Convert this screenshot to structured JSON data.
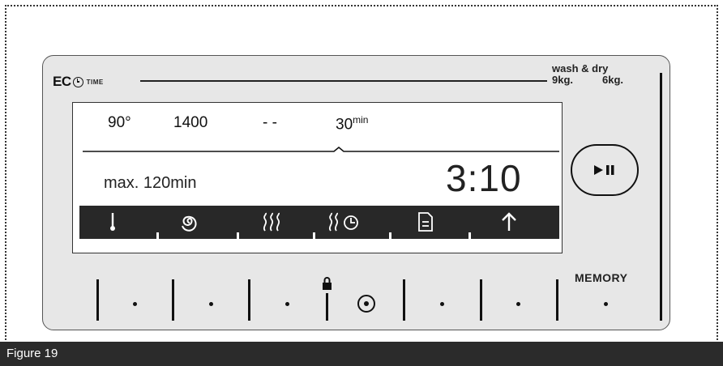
{
  "logo": {
    "eco": "EC",
    "time": "TIME"
  },
  "capacity": {
    "label": "wash & dry",
    "wash": "9kg.",
    "dry": "6kg."
  },
  "display": {
    "temperature": "90°",
    "spin": "1400",
    "option": "- -",
    "duration_value": "30",
    "duration_unit": "min",
    "max_time": "max. 120min",
    "remaining_time": "3:10",
    "icons": [
      "thermometer-icon",
      "spiral-icon",
      "steam-icon",
      "steam-timer-icon",
      "document-icon",
      "arrow-up-icon"
    ]
  },
  "controls": {
    "start_pause_icon": "play-pause-icon",
    "memory_label": "MEMORY",
    "lock_icon": "lock-icon",
    "start_delay_icon": "circle-dot-icon"
  },
  "caption": {
    "text": "Figure 19"
  },
  "colors": {
    "panel": "#e7e7e7",
    "display_bar": "#282828",
    "caption_bg": "#2b2b2b"
  }
}
